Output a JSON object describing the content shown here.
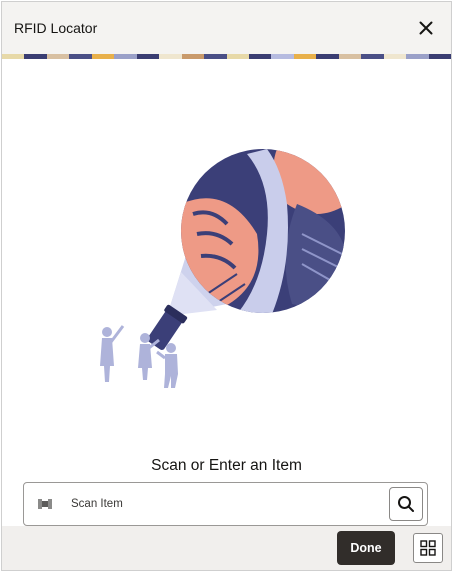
{
  "window": {
    "title": "RFID Locator"
  },
  "header": {
    "close_icon": "close-icon",
    "pattern_colors": [
      "#e7d9a8",
      "#3a3d72",
      "#d8c0a2",
      "#4a4f86",
      "#e8b04a",
      "#9aa0c8",
      "#3a3d72",
      "#efe6cf",
      "#c99a6b",
      "#4a4f86",
      "#e7d9a8",
      "#3a3d72",
      "#b6bbe0",
      "#e8b04a",
      "#3a3d72",
      "#d8c0a2",
      "#4a4f86",
      "#efe6cf",
      "#9aa0c8",
      "#3a3d72"
    ]
  },
  "main": {
    "illustration": "flashlight-search-illustration",
    "prompt": "Scan or Enter an Item"
  },
  "search": {
    "placeholder": "Scan Item",
    "value": "",
    "barcode_icon": "barcode-scan-icon",
    "search_icon": "search-icon"
  },
  "footer": {
    "done_label": "Done",
    "apps_icon": "grid-icon"
  },
  "colors": {
    "header_bg": "#f4f3f1",
    "footer_bg": "#f1efed",
    "primary_button": "#312d2a",
    "illustration_navy": "#3b3f78",
    "illustration_coral": "#ee9a86",
    "illustration_lavender": "#c9cdeb"
  }
}
